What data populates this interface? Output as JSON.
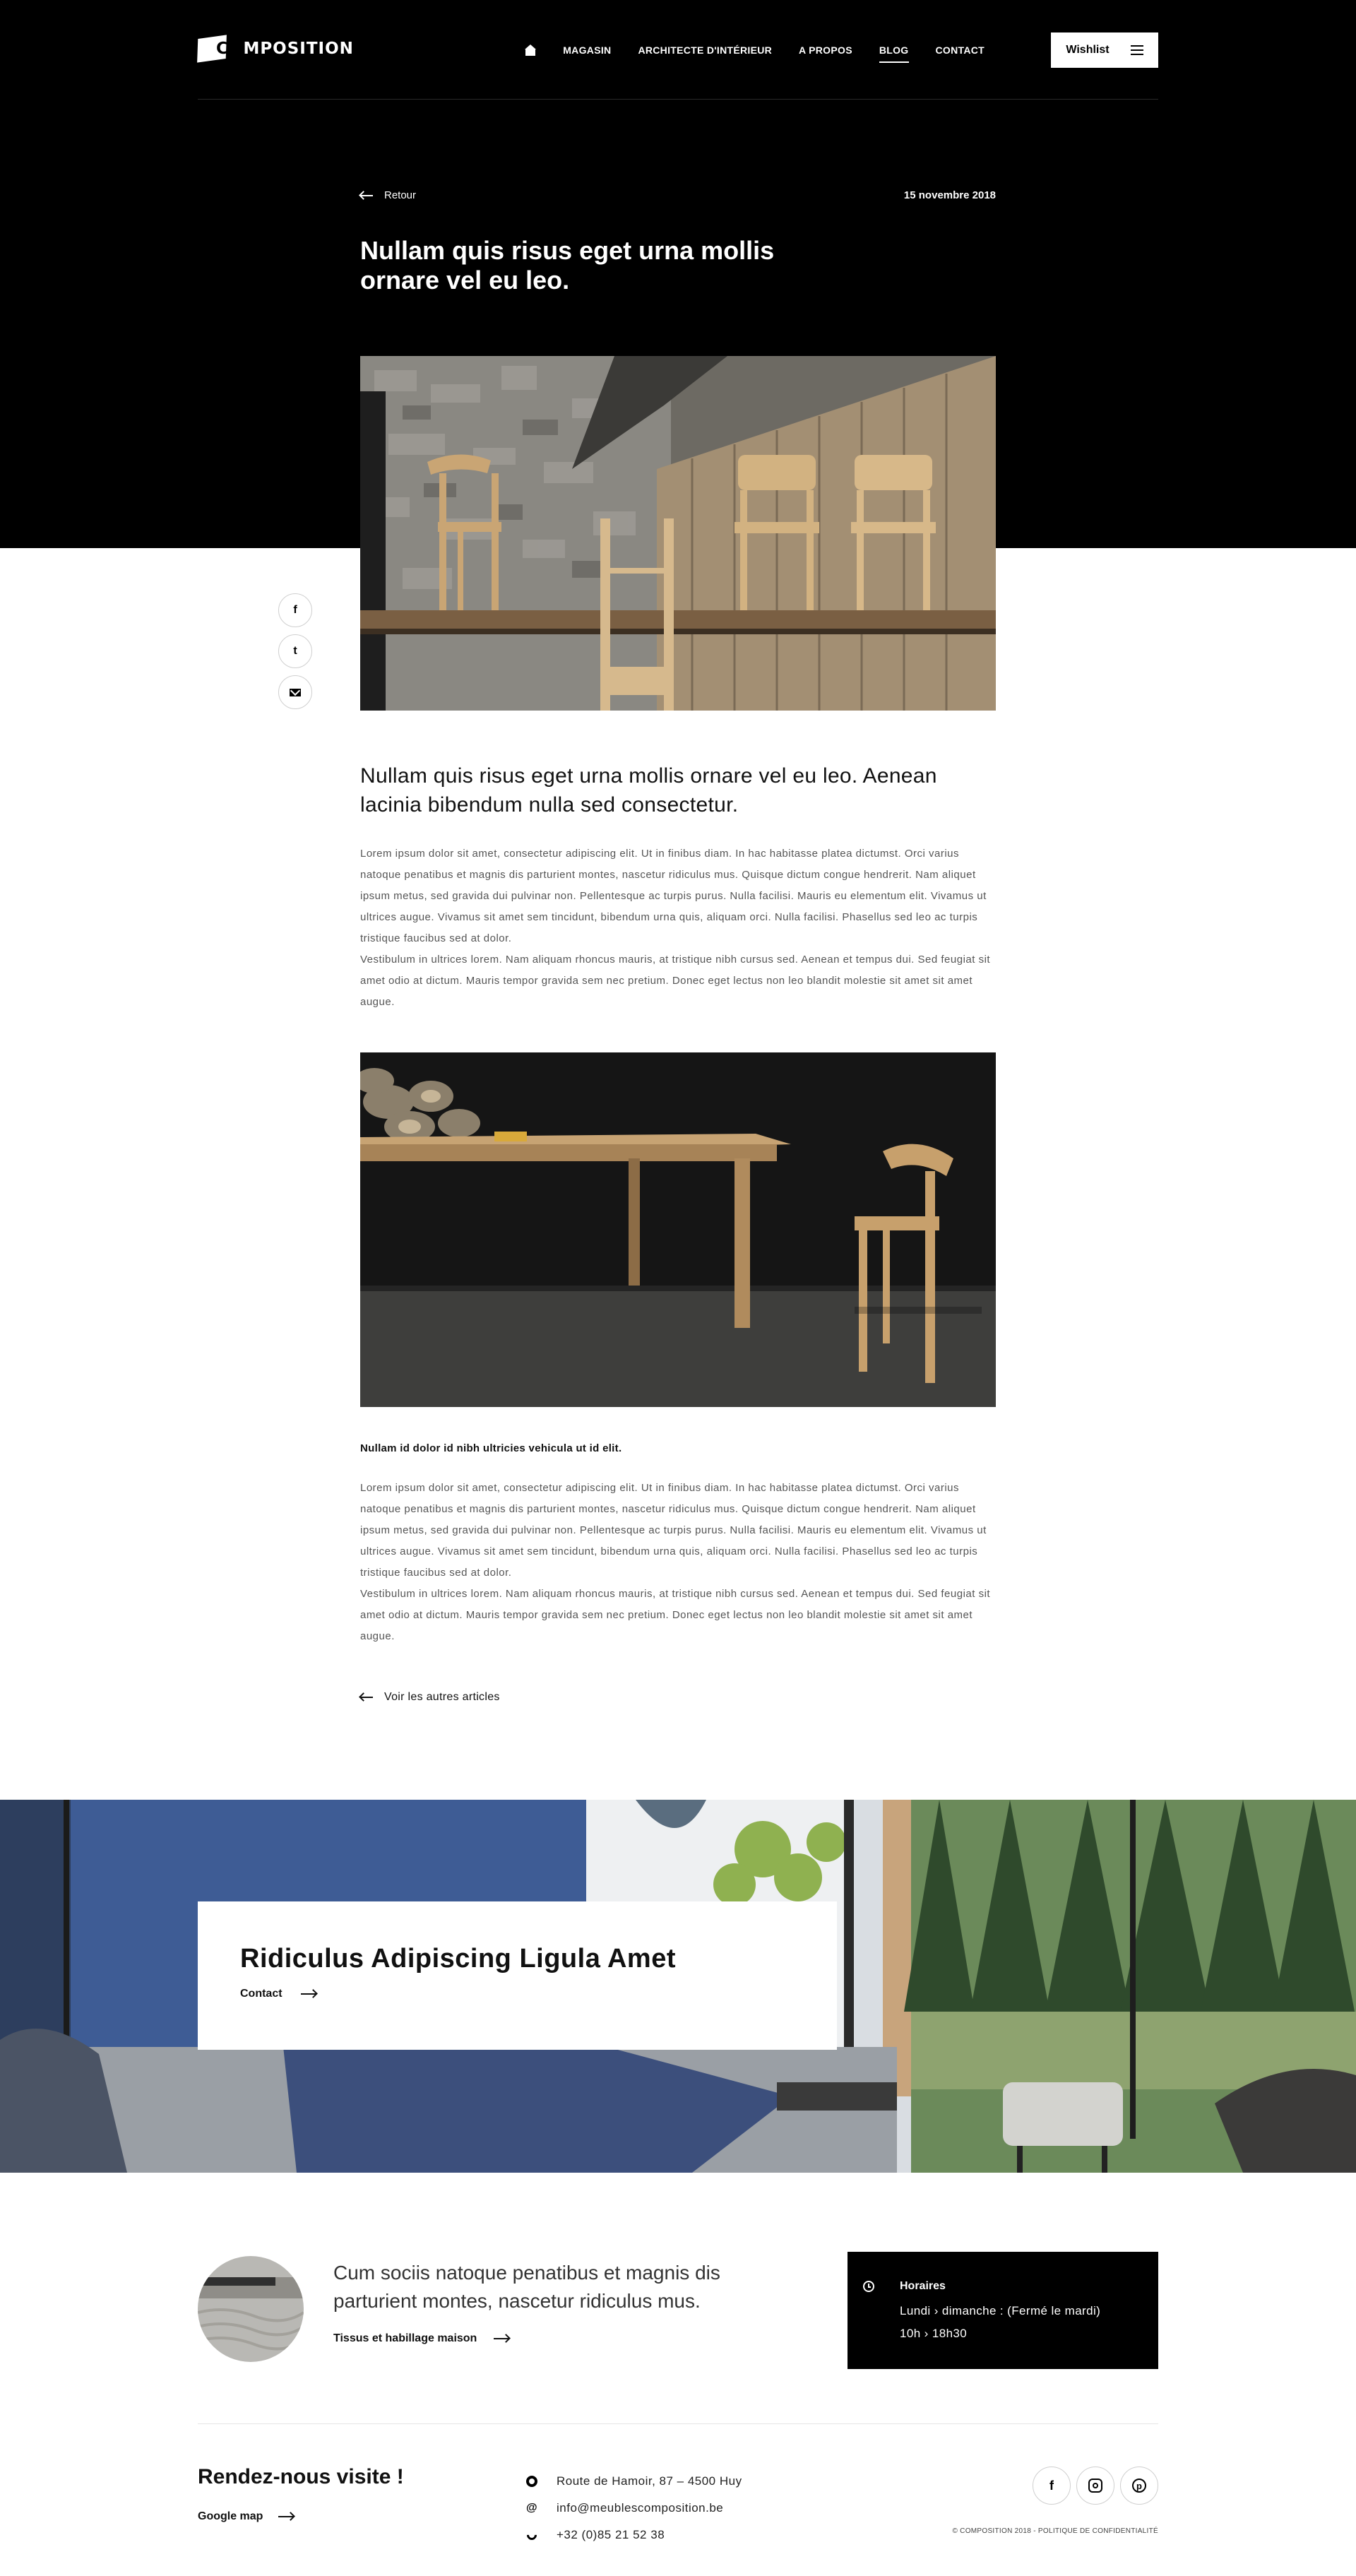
{
  "header": {
    "logo_text": "COMPOSITION",
    "nav": [
      {
        "label": ""
      },
      {
        "label": "MAGASIN"
      },
      {
        "label": "ARCHITECTE D'INTÉRIEUR"
      },
      {
        "label": "A PROPOS"
      },
      {
        "label": "BLOG"
      },
      {
        "label": "CONTACT"
      }
    ],
    "active_nav": "BLOG",
    "wishlist_label": "Wishlist"
  },
  "article": {
    "back_label": "Retour",
    "date": "15 novembre 2018",
    "title": "Nullam quis risus eget urna mollis ornare vel eu leo.",
    "lead": "Nullam quis risus eget urna mollis ornare vel eu leo. Aenean lacinia bibendum nulla sed consectetur.",
    "body_1": "Lorem ipsum dolor sit amet, consectetur adipiscing elit. Ut in finibus diam. In hac habitasse platea dictumst. Orci varius natoque penatibus et magnis dis parturient montes, nascetur ridiculus mus. Quisque dictum congue hendrerit. Nam aliquet ipsum metus, sed gravida dui pulvinar non. Pellentesque ac turpis purus. Nulla facilisi. Mauris eu elementum elit. Vivamus ut ultrices augue. Vivamus sit amet sem tincidunt, bibendum urna quis, aliquam orci. Nulla facilisi. Phasellus sed leo ac turpis tristique faucibus sed at dolor.",
    "body_1b": "Vestibulum in ultrices lorem. Nam aliquam rhoncus mauris, at tristique nibh cursus sed. Aenean et tempus dui. Sed feugiat sit amet odio at dictum. Mauris tempor gravida sem nec pretium. Donec eget lectus non leo blandit molestie sit amet sit amet augue.",
    "subhead": "Nullam id dolor id nibh ultricies vehicula ut id elit.",
    "body_2": "Lorem ipsum dolor sit amet, consectetur adipiscing elit. Ut in finibus diam. In hac habitasse platea dictumst. Orci varius natoque penatibus et magnis dis parturient montes, nascetur ridiculus mus. Quisque dictum congue hendrerit. Nam aliquet ipsum metus, sed gravida dui pulvinar non. Pellentesque ac turpis purus. Nulla facilisi. Mauris eu elementum elit. Vivamus ut ultrices augue. Vivamus sit amet sem tincidunt, bibendum urna quis, aliquam orci. Nulla facilisi. Phasellus sed leo ac turpis tristique faucibus sed at dolor.",
    "body_2b": "Vestibulum in ultrices lorem. Nam aliquam rhoncus mauris, at tristique nibh cursus sed. Aenean et tempus dui. Sed feugiat sit amet odio at dictum. Mauris tempor gravida sem nec pretium. Donec eget lectus non leo blandit molestie sit amet sit amet augue.",
    "more_label": "Voir les autres articles"
  },
  "share": {
    "icons": [
      "facebook-icon",
      "twitter-icon",
      "mail-icon"
    ],
    "facebook_glyph": "f",
    "twitter_glyph": "t"
  },
  "banner": {
    "title": "Ridiculus Adipiscing Ligula Amet",
    "contact_label": "Contact"
  },
  "promo": {
    "text": "Cum sociis natoque penatibus et magnis dis parturient montes, nascetur ridiculus mus.",
    "link_label": "Tissus et habillage maison"
  },
  "hours": {
    "title": "Horaires",
    "line1": "Lundi › dimanche :  (Fermé le mardi)",
    "line2": "10h › 18h30"
  },
  "footer": {
    "visit_title": "Rendez-nous visite !",
    "map_label": "Google map",
    "address": "Route de Hamoir, 87 – 4500 Huy",
    "email": "info@meublescomposition.be",
    "phone": "+32 (0)85 21 52 38",
    "at_glyph": "@",
    "copyright": "© COMPOSITION 2018 - POLITIQUE DE CONFIDENTIALITÉ",
    "social_glyphs": {
      "facebook": "f",
      "pinterest": "p"
    }
  },
  "colors": {
    "hero_bg": "#000000",
    "text": "#111111",
    "body_text": "#555555",
    "hours_bg": "#000000"
  }
}
